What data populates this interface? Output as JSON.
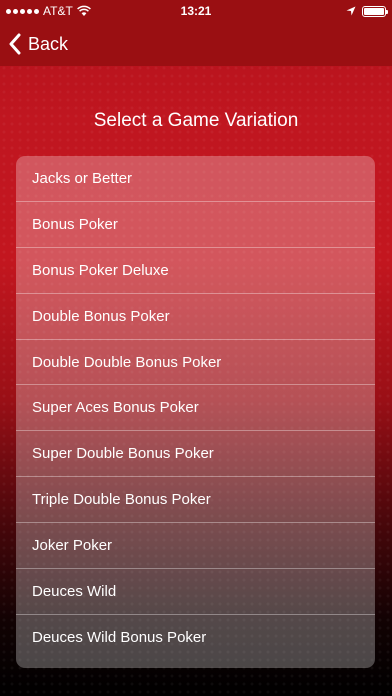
{
  "status_bar": {
    "carrier": "AT&T",
    "time": "13:21"
  },
  "nav": {
    "back_label": "Back"
  },
  "title": "Select a Game Variation",
  "games": [
    "Jacks or Better",
    "Bonus Poker",
    "Bonus Poker Deluxe",
    "Double Bonus Poker",
    "Double Double Bonus Poker",
    "Super Aces Bonus Poker",
    "Super Double Bonus Poker",
    "Triple Double Bonus Poker",
    "Joker Poker",
    "Deuces Wild",
    "Deuces Wild Bonus Poker"
  ],
  "icons": [
    "signal-icon",
    "wifi-icon",
    "location-icon",
    "battery-icon",
    "chevron-left-icon"
  ],
  "colors": {
    "nav_background": "#9a0f12",
    "background_top": "#c3161f",
    "background_bottom": "#000000",
    "text": "#ffffff"
  }
}
